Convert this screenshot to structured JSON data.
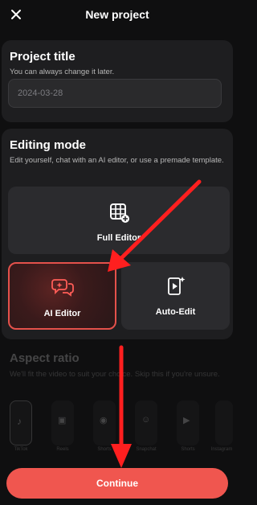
{
  "header": {
    "title": "New project"
  },
  "project_title": {
    "heading": "Project title",
    "subtitle": "You can always change it later.",
    "value": "2024-03-28"
  },
  "editing_mode": {
    "heading": "Editing mode",
    "subtitle": "Edit yourself, chat with an AI editor, or use a premade template.",
    "full_editor": "Full Editor",
    "ai_editor": "AI Editor",
    "auto_edit": "Auto-Edit"
  },
  "aspect_ratio": {
    "heading": "Aspect ratio",
    "subtitle": "We'll fit the video to suit your choice. Skip this if you're unsure.",
    "items": [
      "TikTok",
      "Reels",
      "Shorts",
      "Snapchat",
      "Shorts",
      "Instagram"
    ]
  },
  "actions": {
    "continue_label": "Continue"
  },
  "colors": {
    "accent": "#f0564f",
    "background": "#0f0f10",
    "card": "#1e1e20"
  }
}
